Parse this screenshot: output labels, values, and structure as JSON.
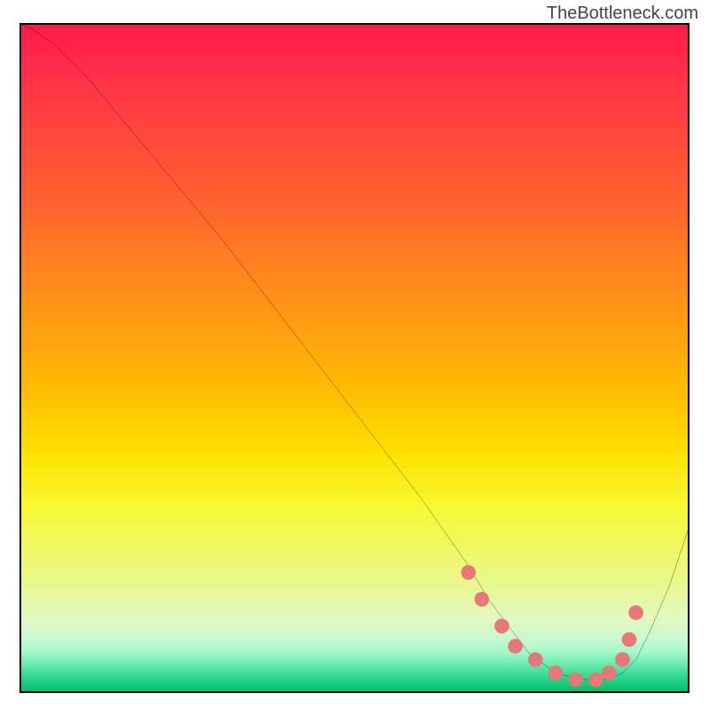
{
  "watermark": "TheBottleneck.com",
  "chart_data": {
    "type": "line",
    "title": "",
    "xlabel": "",
    "ylabel": "",
    "xlim": [
      0,
      100
    ],
    "ylim": [
      0,
      100
    ],
    "series": [
      {
        "name": "curve",
        "x": [
          0,
          2,
          5,
          10,
          20,
          30,
          40,
          50,
          60,
          67,
          70,
          73,
          76,
          80,
          84,
          88,
          90,
          92,
          94,
          97,
          100
        ],
        "y": [
          100,
          99,
          97,
          92,
          80,
          68,
          55,
          42,
          29,
          19,
          14,
          10,
          6,
          3,
          2,
          2,
          3,
          5,
          9,
          16,
          25
        ]
      }
    ],
    "markers": {
      "name": "dots",
      "color": "#e87878",
      "x": [
        67,
        69,
        72,
        74,
        77,
        80,
        83,
        86,
        88,
        90,
        91,
        92
      ],
      "y": [
        18,
        14,
        10,
        7,
        5,
        3,
        2,
        2,
        3,
        5,
        8,
        12
      ]
    },
    "gradient_stops": [
      {
        "pos": 0.0,
        "color": "#ff1a4a"
      },
      {
        "pos": 0.3,
        "color": "#ff7028"
      },
      {
        "pos": 0.6,
        "color": "#ffd000"
      },
      {
        "pos": 0.8,
        "color": "#f0f870"
      },
      {
        "pos": 0.93,
        "color": "#b0f8c8"
      },
      {
        "pos": 1.0,
        "color": "#00b868"
      }
    ],
    "grid": false,
    "legend": false
  }
}
